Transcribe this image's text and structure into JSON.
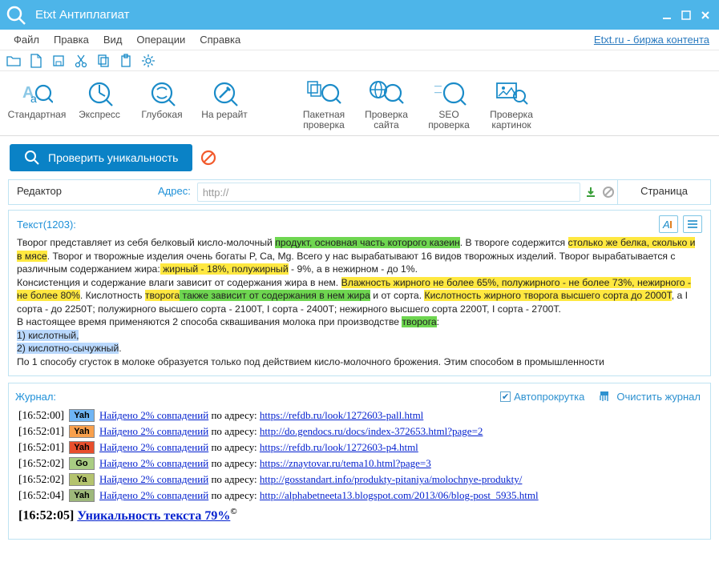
{
  "app": {
    "title": "Etxt Антиплагиат",
    "ext_link": "Etxt.ru - биржа контента"
  },
  "menu": {
    "file": "Файл",
    "edit": "Правка",
    "view": "Вид",
    "ops": "Операции",
    "help": "Справка"
  },
  "bigbar": {
    "standard": "Стандартная",
    "express": "Экспресс",
    "deep": "Глубокая",
    "rewrite": "На рерайт",
    "batch": "Пакетная проверка",
    "site": "Проверка сайта",
    "seo": "SEO проверка",
    "img": "Проверка картинок"
  },
  "check": {
    "btn": "Проверить уникальность"
  },
  "addr": {
    "editor": "Редактор",
    "label": "Адрес:",
    "value": "http://",
    "tab": "Страница"
  },
  "editor": {
    "title": "Текст(1203):",
    "text": {
      "p1a": "Творог представляет из себя белковый кисло-молочный ",
      "p1h1": "продукт, основная часть которого казеин",
      "p1b": ". В твороге содержится ",
      "p1h2": "столько же белка, сколько и в мясе",
      "p1c": ". Творог и творожные изделия очень богаты P, Ca, Mg. Всего у нас вырабатывают 16 видов творожных изделий. Творог вырабатывается с различным содержанием жира:",
      "p1h3": " жирный - 18%, полужирный",
      "p1d": " - 9%, а в нежирном - до 1%.",
      "p2a": "Консистенция и содержание влаги зависит от содержания жира в нем. ",
      "p2h1": "Влажность жирного не более 65%, полужирного - не более 73%, нежирного - не более 80%",
      "p2b": ". Кислотность ",
      "p2h2": "творога",
      "p2h3": " также зависит от содержания в нем жира",
      "p2c": " и от сорта. ",
      "p2h4": "Кислотность жирного творога высшего сорта до 2000Т",
      "p2d": ", а I сорта - до 2250Т; полужирного высшего сорта - 2100Т, I сорта - 2400Т; нежирного высшего сорта 2200Т, I сорта - 2700Т.",
      "p3a": "В настоящее время применяются 2 способа сквашивания молока при производстве ",
      "p3h1": "творога",
      "p3b": ":",
      "p4": "1) кислотный,",
      "p5": "2) кислотно-сычужный",
      "p5b": ".",
      "p6": "По 1 способу сгусток в молоке образуется только под действием кисло-молочного брожения. Этим способом в промышленности"
    }
  },
  "journal": {
    "title": "Журнал:",
    "auto": "Автопрокрутка",
    "clear": "Очистить журнал",
    "rows": [
      {
        "time": "[16:52:00]",
        "eng": "Yah",
        "engcls": "eng-yah-blue",
        "link1": "Найдено 2% совпадений",
        "mid": " по адресу: ",
        "url": "https://refdb.ru/look/1272603-pall.html"
      },
      {
        "time": "[16:52:01]",
        "eng": "Yah",
        "engcls": "eng-yah-orange",
        "link1": "Найдено 2% совпадений",
        "mid": " по адресу: ",
        "url": "http://do.gendocs.ru/docs/index-372653.html?page=2"
      },
      {
        "time": "[16:52:01]",
        "eng": "Yah",
        "engcls": "eng-yah-red",
        "link1": "Найдено 2% совпадений",
        "mid": " по адресу: ",
        "url": "https://refdb.ru/look/1272603-p4.html"
      },
      {
        "time": "[16:52:02]",
        "eng": "Go",
        "engcls": "eng-go",
        "link1": "Найдено 2% совпадений",
        "mid": " по адресу: ",
        "url": "https://znaytovar.ru/tema10.html?page=3"
      },
      {
        "time": "[16:52:02]",
        "eng": "Ya",
        "engcls": "eng-ya",
        "link1": "Найдено 2% совпадений",
        "mid": " по адресу: ",
        "url": "http://gosstandart.info/produkty-pitaniya/molochnye-produkty/"
      },
      {
        "time": "[16:52:04]",
        "eng": "Yah",
        "engcls": "eng-yah-green",
        "link1": "Найдено 2% совпадений",
        "mid": " по адресу: ",
        "url": "http://alphabetneeta13.blogspot.com/2013/06/blog-post_5935.html"
      }
    ],
    "final_time": "[16:52:05]",
    "final_text": "Уникальность текста 79%"
  }
}
